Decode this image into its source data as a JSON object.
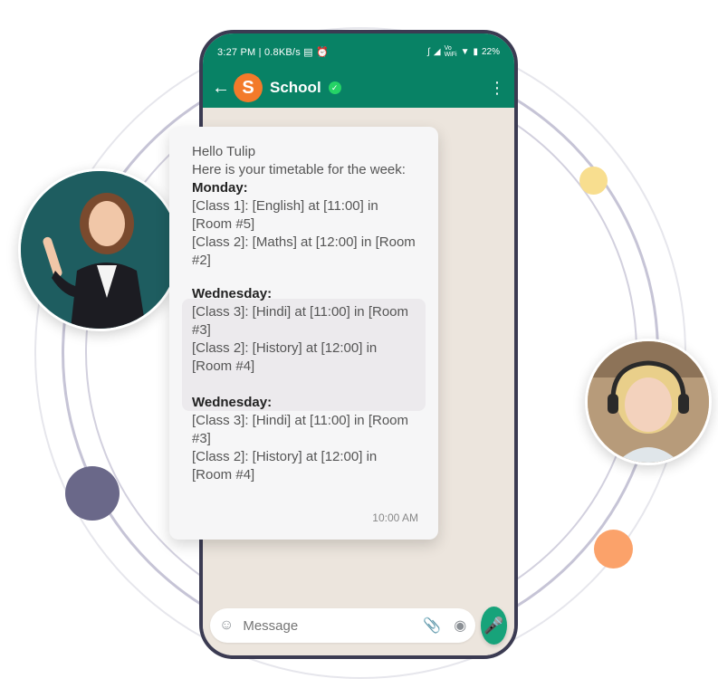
{
  "status_bar": {
    "time": "3:27 PM",
    "network_speed": "0.8KB/s",
    "volte_label": "Vo WiFi",
    "battery": "22%"
  },
  "chat_header": {
    "avatar_letter": "S",
    "name": "School"
  },
  "message": {
    "greeting_line1": "Hello Tulip",
    "greeting_line2": "Here is your timetable for the week:",
    "days": [
      {
        "title": "Monday:",
        "entries": [
          "[Class 1]: [English] at [11:00] in [Room #5]",
          "[Class 2]: [Maths] at [12:00] in [Room #2]"
        ]
      },
      {
        "title": "Wednesday:",
        "entries": [
          "[Class 3]: [Hindi] at [11:00] in [Room #3]",
          "[Class 2]: [History] at [12:00] in [Room #4]"
        ]
      },
      {
        "title": "Wednesday:",
        "entries": [
          "[Class 3]: [Hindi] at [11:00] in [Room #3]",
          "[Class 2]: [History] at [12:00] in [Room #4]"
        ]
      }
    ],
    "timestamp": "10:00 AM"
  },
  "composer": {
    "placeholder": "Message"
  },
  "colors": {
    "header_green": "#088265",
    "chat_background": "#ece5dd",
    "avatar_orange": "#f37a2a",
    "mic_green": "#17a37a",
    "highlight_gray": "#eceaed"
  },
  "icons": [
    "back-arrow-icon",
    "verified-icon",
    "menu-icon",
    "emoji-icon",
    "attach-icon",
    "camera-icon",
    "mic-icon"
  ]
}
